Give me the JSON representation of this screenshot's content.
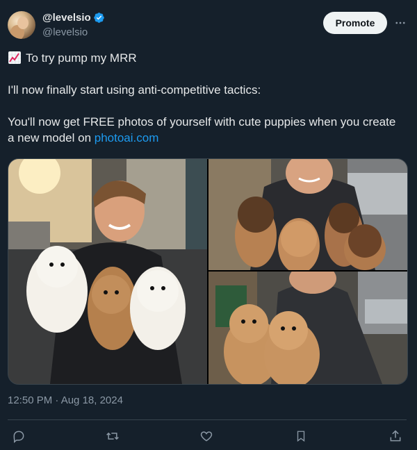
{
  "author": {
    "display_name": "@levelsio",
    "handle": "@levelsio",
    "verified": true
  },
  "header": {
    "promote_label": "Promote",
    "more_icon": "more-horizontal-icon"
  },
  "tweet": {
    "line1_emoji": "chart-increasing-emoji",
    "line1_text": "To try pump my MRR",
    "line2": "I'll now finally start using anti-competitive tactics:",
    "line3_prefix": "You'll now get FREE photos of yourself with cute puppies when you create a new model on ",
    "line3_link": "photoai.com"
  },
  "media": {
    "images": [
      {
        "name": "man-holding-three-puppies-photo"
      },
      {
        "name": "man-with-four-puppies-photo"
      },
      {
        "name": "man-holding-two-puppies-photo"
      }
    ]
  },
  "timestamp": "12:50 PM · Aug 18, 2024",
  "actions": {
    "icons": [
      "reply-icon",
      "retweet-icon",
      "like-icon",
      "bookmark-icon",
      "share-icon"
    ]
  },
  "colors": {
    "background": "#15202b",
    "link": "#1d9bf0",
    "muted": "#8b98a5",
    "verified": "#1d9bf0"
  }
}
